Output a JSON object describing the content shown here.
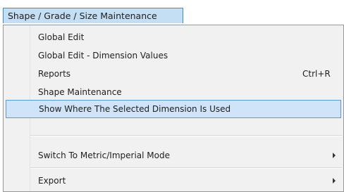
{
  "menubar": {
    "open_menu_label": "Shape / Grade / Size Maintenance"
  },
  "dropdown": {
    "items": [
      {
        "label": "Global Edit",
        "shortcut": ""
      },
      {
        "label": "Global Edit - Dimension Values",
        "shortcut": ""
      },
      {
        "label": "Reports",
        "shortcut": "Ctrl+R"
      },
      {
        "label": "Shape Maintenance",
        "shortcut": ""
      },
      {
        "label": "Show Where The Selected Dimension Is Used",
        "shortcut": "",
        "highlighted": true
      },
      {
        "label": "Switch To Metric/Imperial Mode",
        "shortcut": "",
        "submenu": true
      },
      {
        "label": "Export",
        "shortcut": "",
        "submenu": true
      }
    ]
  },
  "colors": {
    "menubar_item_bg": "#c4def4",
    "menubar_item_border": "#3c8dd0",
    "dropdown_bg": "#f1f1f1",
    "dropdown_border": "#979797",
    "highlight_bg": "#cfe4f8",
    "highlight_border": "#5c9ad6"
  }
}
